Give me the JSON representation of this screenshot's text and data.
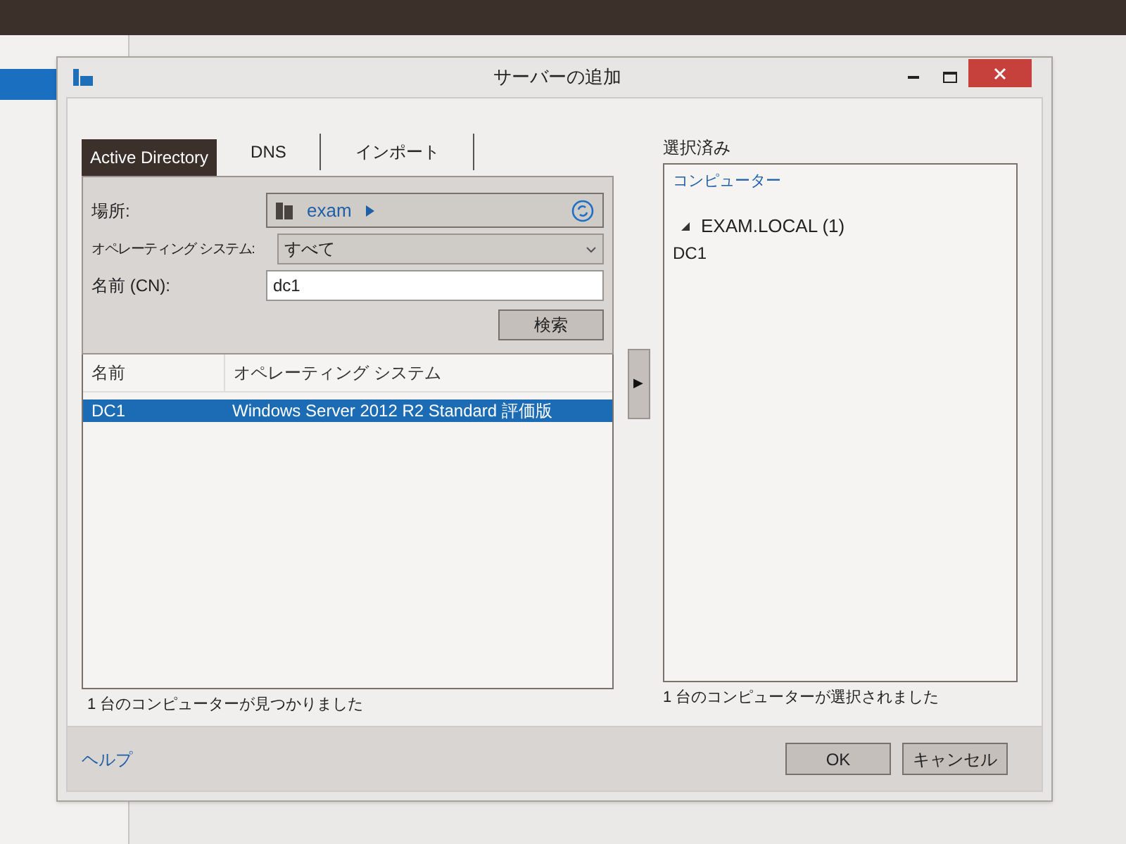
{
  "dialog": {
    "title": "サーバーの追加"
  },
  "tabs": [
    {
      "label": "Active Directory",
      "selected": true
    },
    {
      "label": "DNS",
      "selected": false
    },
    {
      "label": "インポート",
      "selected": false
    }
  ],
  "search": {
    "location_label": "場所:",
    "location_value": "exam",
    "os_label": "オペレーティング システム:",
    "os_value": "すべて",
    "name_label": "名前 (CN):",
    "name_value": "dc1",
    "search_button": "検索"
  },
  "results": {
    "columns": [
      "名前",
      "オペレーティング システム"
    ],
    "rows": [
      {
        "name": "DC1",
        "os": "Windows Server 2012 R2 Standard 評価版",
        "selected": true
      }
    ],
    "status": "1 台のコンピューターが見つかりました"
  },
  "add_button": "▶",
  "selected_panel": {
    "title": "選択済み",
    "column": "コンピューター",
    "groups": [
      {
        "label": "EXAM.LOCAL (1)",
        "expanded": true,
        "children": [
          "DC1"
        ]
      }
    ],
    "status": "1 台のコンピューターが選択されました"
  },
  "footer": {
    "help_link": "ヘルプ",
    "buttons": [
      "OK",
      "キャンセル"
    ]
  }
}
